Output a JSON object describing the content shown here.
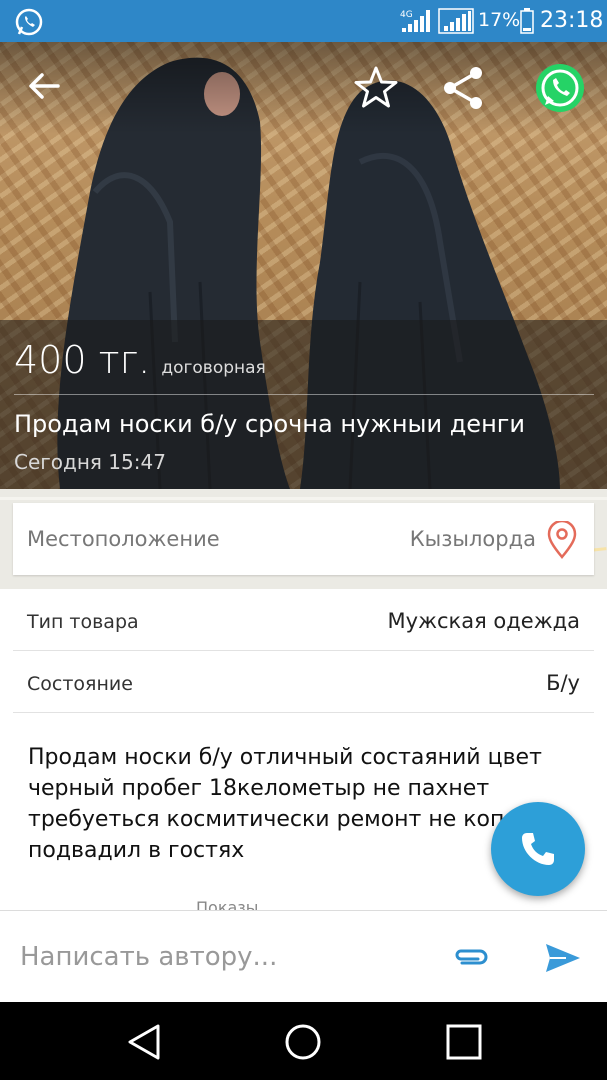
{
  "status_bar": {
    "network_label": "4G",
    "battery_text": "17%",
    "time": "23:18"
  },
  "listing": {
    "price": "400 тг.",
    "price_note": "договорная",
    "title": "Продам носки б/у срочна нужныи денги",
    "date": "Сегодня 15:47",
    "location_label": "Местоположение",
    "location_value": "Кызылорда",
    "details": [
      {
        "key": "Тип товара",
        "value": "Мужская одежда"
      },
      {
        "key": "Состояние",
        "value": "Б/у"
      }
    ],
    "description": "Продам носки б/у отличный состаяний цвет\nчерный пробег 18келометыр  не пахнет\nтребуеться космитически ремонт не коп\nподвадил  в гостях",
    "views_label": "Показы"
  },
  "compose": {
    "placeholder": "Написать автору..."
  },
  "icons": {
    "back": "arrow-left-icon",
    "favorite": "star-icon",
    "share": "share-icon",
    "whatsapp": "whatsapp-icon",
    "location": "map-pin-icon",
    "call": "phone-icon",
    "attach": "paperclip-icon",
    "send": "send-icon"
  },
  "colors": {
    "status_bar": "#2e87c8",
    "fab": "#2d9fd8",
    "send": "#3a9ad9",
    "pin": "#e46b5a",
    "whatsapp": "#25d366"
  }
}
